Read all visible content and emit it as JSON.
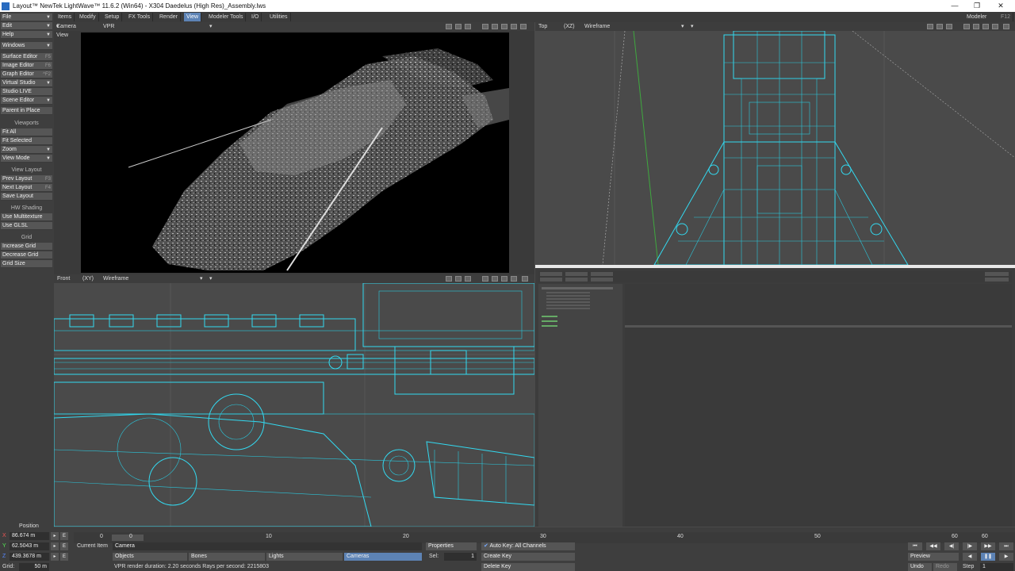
{
  "window": {
    "title": "Layout™ NewTek LightWave™ 11.6.2 (Win64) - X304 Daedelus (High Res)_Assembly.lws",
    "minimize": "—",
    "restore": "❐",
    "close": "✕"
  },
  "tabs": [
    "Items",
    "Modify",
    "Setup",
    "FX Tools",
    "Render",
    "View",
    "Modeler Tools",
    "I/O",
    "Utilities"
  ],
  "active_tab": "View",
  "modeler_button": {
    "label": "Modeler",
    "shortcut": "F12"
  },
  "left_toolbar": {
    "menus": [
      "File",
      "Edit",
      "Help"
    ],
    "windows": "Windows",
    "editors": [
      {
        "label": "Surface Editor",
        "shortcut": "F5"
      },
      {
        "label": "Image Editor",
        "shortcut": "F6"
      },
      {
        "label": "Graph Editor",
        "shortcut": "^F2"
      },
      {
        "label": "Virtual Studio",
        "shortcut": ""
      },
      {
        "label": "Studio LIVE",
        "shortcut": ""
      },
      {
        "label": "Scene Editor",
        "shortcut": ""
      }
    ],
    "parent_in_place": "Parent in Place",
    "viewports_header": "Viewports",
    "viewports": [
      "Fit All",
      "Fit Selected",
      "Zoom",
      "View Mode"
    ],
    "view_layout_header": "View Layout",
    "view_layout": [
      {
        "label": "Prev Layout",
        "shortcut": "F3"
      },
      {
        "label": "Next Layout",
        "shortcut": "F4"
      },
      {
        "label": "Save Layout",
        "shortcut": ""
      }
    ],
    "hw_shading_header": "HW Shading",
    "hw_shading": [
      "Use Multitexture",
      "Use GLSL"
    ],
    "grid_header": "Grid",
    "grid": [
      "Increase Grid",
      "Decrease Grid",
      "Grid Size"
    ]
  },
  "viewports": {
    "top_left": {
      "view": "Camera View",
      "mode": "VPR"
    },
    "top_right": {
      "view": "Top",
      "axes": "(XZ)",
      "mode": "Wireframe"
    },
    "bottom_left": {
      "view": "Front",
      "axes": "(XY)",
      "mode": "Wireframe"
    }
  },
  "position": {
    "label": "Position",
    "x": "86.674 m",
    "y": "62.5043 m",
    "z": "439.3678 m",
    "grid_label": "Grid:",
    "grid": "50 m"
  },
  "timeline": {
    "ticks": [
      "0",
      "10",
      "20",
      "30",
      "40",
      "50",
      "60"
    ],
    "start_frame": "0",
    "end_frame": "60"
  },
  "item_controls": {
    "current_item_label": "Current Item",
    "current_item": "Camera",
    "properties": "Properties",
    "sel_label": "Sel:",
    "sel_value": "1",
    "objects": "Objects",
    "bones": "Bones",
    "lights": "Lights",
    "cameras": "Cameras",
    "status": "VPR render duration: 2.20 seconds  Rays per second: 2215803"
  },
  "key_controls": {
    "auto_key": "Auto Key: All Channels",
    "create_key": "Create Key",
    "delete_key": "Delete Key"
  },
  "playback": {
    "preview": "Preview",
    "step_label": "Step",
    "step": "1",
    "undo": "Undo",
    "redo": "Redo"
  },
  "colors": {
    "wireframe": "#33d9f0",
    "active_tab": "#5d83b5",
    "viewport_bg": "#4a4a4a",
    "vpr_bg": "#000000"
  }
}
